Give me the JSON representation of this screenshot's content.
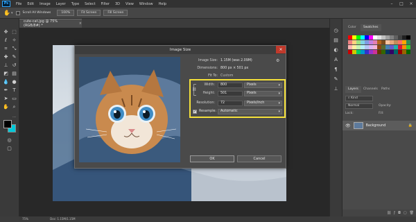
{
  "menubar": {
    "logo": "Ps",
    "items": [
      "File",
      "Edit",
      "Image",
      "Layer",
      "Type",
      "Select",
      "Filter",
      "3D",
      "View",
      "Window",
      "Help"
    ]
  },
  "optionsbar": {
    "scroll_all": "Scroll All Windows",
    "zoom": "100%",
    "fit_screen": "Fit Screen",
    "fill_screen": "Fill Screen"
  },
  "document": {
    "tab": "cute-cat.jpg @ 75% (RGB/8#) *"
  },
  "dialog": {
    "title": "Image Size",
    "image_size_label": "Image Size:",
    "image_size_value": "1.15M (was 2.09M)",
    "dimensions_label": "Dimensions:",
    "dimensions_value": "800 px × 501 px",
    "fit_to_label": "Fit To:",
    "fit_to_value": "Custom",
    "width_label": "Width:",
    "width_value": "800",
    "width_unit": "Pixels",
    "height_label": "Height:",
    "height_value": "501",
    "height_unit": "Pixels",
    "resolution_label": "Resolution:",
    "resolution_value": "72",
    "resolution_unit": "Pixels/Inch",
    "resample_label": "Resample:",
    "resample_value": "Automatic",
    "ok": "OK",
    "cancel": "Cancel"
  },
  "panels": {
    "top_tabs": [
      "Color",
      "Swatches"
    ],
    "layer_tabs": [
      "Layers",
      "Channels",
      "Paths"
    ],
    "kind": "Kind",
    "blend": "Normal",
    "opacity_label": "Opacity:",
    "lock_label": "Lock:",
    "fill_label": "Fill:",
    "layer_name": "Background"
  },
  "statusbar": {
    "zoom": "75%",
    "doc": "Doc: 1.15M/1.15M"
  },
  "colors": {
    "highlight": "#f5e13a",
    "foreground": "#000000",
    "background": "#00c8d8"
  }
}
